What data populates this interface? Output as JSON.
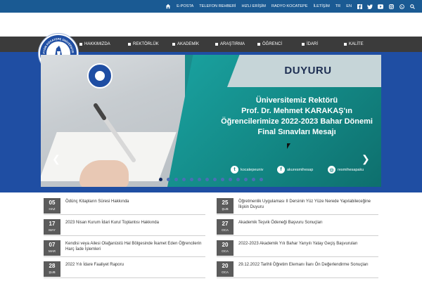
{
  "topbar": {
    "links": [
      "E-POSTA",
      "TELEFON REHBERİ",
      "HIZLI ERİŞİM",
      "RADYO KOCATEPE",
      "İLETİŞİM",
      "TR",
      "EN"
    ],
    "icons": [
      "home-icon",
      "facebook-icon",
      "twitter-icon",
      "youtube-icon",
      "instagram-icon",
      "whatsapp-icon",
      "search-icon"
    ]
  },
  "nav": {
    "items": [
      "HAKKIMIZDA",
      "REKTÖRLÜK",
      "AKADEMİK",
      "ARAŞTIRMA",
      "ÖĞRENCİ",
      "İDARİ",
      "KALİTE"
    ]
  },
  "logo": {
    "top_text": "AFYON KOCATEPE ÜNİVERSİTESİ",
    "year": "1992"
  },
  "slide": {
    "badge": "DUYURU",
    "headline_line1": "Üniversitemiz Rektörü",
    "headline_line2": "Prof. Dr. Mehmet KARAKAŞ'ın",
    "headline_line3": "Öğrencilerimize 2022-2023 Bahar Dönemi",
    "headline_line4": "Final Sınavları Mesajı",
    "social": [
      {
        "icon": "twitter-icon",
        "handle": "kocatepeuniv"
      },
      {
        "icon": "facebook-icon",
        "handle": "akuresmihesap"
      },
      {
        "icon": "instagram-icon",
        "handle": "resmihesapaku"
      }
    ],
    "dots_total": 14,
    "dots_active": 0
  },
  "news": {
    "left": [
      {
        "day": "05",
        "month": "HAZ",
        "title": "Ödünç Kitapların Süresi Hakkında"
      },
      {
        "day": "17",
        "month": "MAY",
        "title": "2023 Nisan Kurum İdari Kurul Toplantısı Hakkında"
      },
      {
        "day": "07",
        "month": "MAR",
        "title": "Kendisi veya Ailesi Olağanüstü Hal Bölgesinde İkamet Eden Öğrencilerin Harç İade İşlemleri"
      },
      {
        "day": "28",
        "month": "ŞUB",
        "title": "2022 Yılı İdare Faaliyet Raporu"
      }
    ],
    "right": [
      {
        "day": "25",
        "month": "ŞUB",
        "title": "Öğretmenlik Uygulaması II Dersinin Yüz Yüze Nerede Yapılabileceğine İlişkin Duyuru"
      },
      {
        "day": "27",
        "month": "OCA",
        "title": "Akademik Teşvik Ödeneği Başvuru Sonuçları"
      },
      {
        "day": "20",
        "month": "OCA",
        "title": "2022-2023 Akademik Yılı Bahar Yarıyılı Yatay Geçiş Başvuruları"
      },
      {
        "day": "20",
        "month": "OCA",
        "title": "29.12.2022 Tarihli Öğretim Elemanı İlanı Ön Değerlendirme Sonuçları"
      }
    ]
  },
  "colors": {
    "topbar": "#1a5a93",
    "navbar": "#3b3b3b",
    "brand_blue": "#1f4ea3",
    "slide_teal": "#138885",
    "date_box": "#5b5b5b"
  }
}
